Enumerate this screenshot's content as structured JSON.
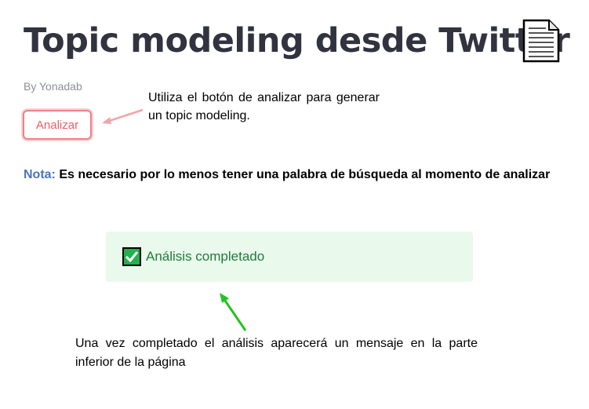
{
  "header": {
    "title": "Topic modeling desde Twitter",
    "title_icon": "document-icon",
    "byline": "By Yonadab"
  },
  "controls": {
    "analyze_button_label": "Analizar"
  },
  "annotations": {
    "analyze_hint": "Utiliza el botón de analizar para generar un topic modeling.",
    "completion_hint": "Una vez completado el análisis aparecerá un mensaje en la parte inferior de la página"
  },
  "note": {
    "label": "Nota:",
    "text": "Es necesario por lo menos tener una palabra de búsqueda al momento de analizar"
  },
  "status": {
    "icon": "check-icon",
    "message": "Análisis completado"
  },
  "colors": {
    "title": "#31333f",
    "button_accent": "#ef5e67",
    "note_label": "#4b74b9",
    "success_bg": "#e9f9ec",
    "success_text": "#207a3c",
    "arrow_red": "#f2a4aa",
    "arrow_green": "#22c322"
  }
}
